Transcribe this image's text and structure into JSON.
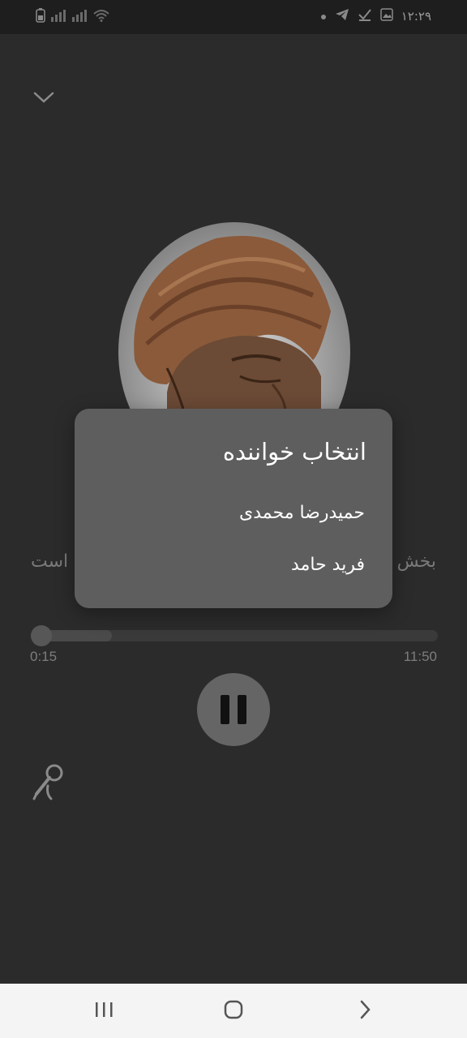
{
  "status_bar": {
    "time": "۱۲:۲۹",
    "left_icons": [
      "battery-icon",
      "signal-icon",
      "signal-icon",
      "wifi-icon"
    ],
    "right_icons": [
      "dot-icon",
      "telegram-icon",
      "check-icon",
      "gallery-icon"
    ]
  },
  "player": {
    "collapse_icon": "chevron-down-icon",
    "title_right_fragment": "بخش",
    "title_left_fragment": "است",
    "elapsed": "0:15",
    "duration": "11:50",
    "progress_fraction": 0.021,
    "buffer_fraction": 0.2,
    "play_state_icon": "pause-icon",
    "mic_icon": "microphone-icon"
  },
  "dialog": {
    "title": "انتخاب خواننده",
    "options": [
      "حمیدرضا محمدی",
      "فرید حامد"
    ]
  },
  "nav_bar": {
    "icons": [
      "recent-apps-icon",
      "home-icon",
      "back-icon"
    ]
  },
  "colors": {
    "background": "#2b2b2b",
    "dialog": "#5e5e5e",
    "accent": "#656565"
  }
}
